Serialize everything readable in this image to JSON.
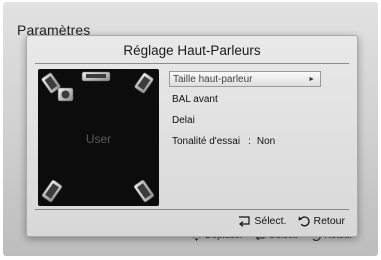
{
  "background": {
    "title": "Paramètres",
    "footer": {
      "move_label": "Déplacer",
      "select_label": "Sélect.",
      "return_label": "Retour"
    }
  },
  "dialog": {
    "title": "Réglage Haut-Parleurs",
    "speaker_preview_label": "User",
    "menu": [
      {
        "label": "Taille haut-parleur",
        "selected": true,
        "arrow": "►"
      },
      {
        "label": "BAL avant"
      },
      {
        "label": "Delai"
      },
      {
        "label": "Tonalité d'essai",
        "separator": ":",
        "value": "Non"
      }
    ],
    "footer": {
      "select_label": "Sélect.",
      "return_label": "Retour"
    }
  },
  "icons": {
    "move": "move-arrows-icon",
    "enter": "enter-icon",
    "return": "return-icon"
  }
}
